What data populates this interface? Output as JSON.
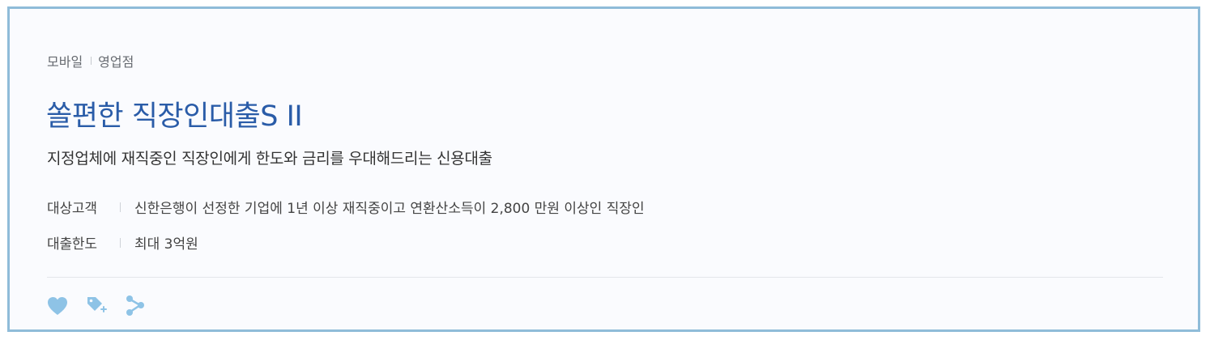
{
  "product": {
    "channels": [
      "모바일",
      "영업점"
    ],
    "title": "쏠편한 직장인대출S II",
    "description": "지정업체에 재직중인 직장인에게 한도와 금리를 우대해드리는 신용대출",
    "info": [
      {
        "label": "대상고객",
        "value": "신한은행이 선정한 기업에 1년 이상 재직중이고 연환산소득이 2,800 만원 이상인 직장인"
      },
      {
        "label": "대출한도",
        "value": "최대 3억원"
      }
    ]
  },
  "actions": {
    "icons": [
      "heart-icon",
      "tag-plus-icon",
      "share-icon"
    ],
    "icon_color": "#8ec3e6"
  },
  "colors": {
    "border": "#8fbcd9",
    "title": "#2a5ca8",
    "background": "#fafbfe"
  }
}
